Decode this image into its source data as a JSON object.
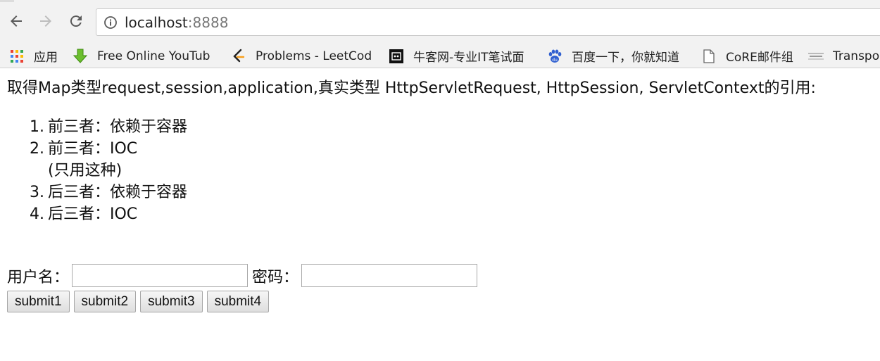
{
  "browser": {
    "url_host": "localhost",
    "url_port": ":8888",
    "bookmarks": [
      {
        "label": "应用",
        "icon": "apps-grid-icon"
      },
      {
        "label": "Free Online YouTub",
        "icon": "download-arrow-icon"
      },
      {
        "label": "Problems - LeetCod",
        "icon": "leetcode-icon"
      },
      {
        "label": "牛客网-专业IT笔试面",
        "icon": "nowcoder-icon"
      },
      {
        "label": "百度一下，你就知道",
        "icon": "baidu-paw-icon"
      },
      {
        "label": "CoRE邮件组",
        "icon": "page-icon"
      },
      {
        "label": "Transpo",
        "icon": "site-icon"
      }
    ]
  },
  "page": {
    "intro": "取得Map类型request,session,application,真实类型 HttpServletRequest, HttpSession, ServletContext的引用:",
    "options": [
      {
        "num": "1.",
        "text": "前三者：依赖于容器"
      },
      {
        "num": "2.",
        "text": "前三者：IOC",
        "note": "(只用这种)"
      },
      {
        "num": "3.",
        "text": "后三者：依赖于容器"
      },
      {
        "num": "4.",
        "text": "后三者：IOC"
      }
    ],
    "form": {
      "username_label": "用户名：",
      "password_label": "密码：",
      "username_value": "",
      "password_value": "",
      "buttons": [
        "submit1",
        "submit2",
        "submit3",
        "submit4"
      ]
    }
  }
}
